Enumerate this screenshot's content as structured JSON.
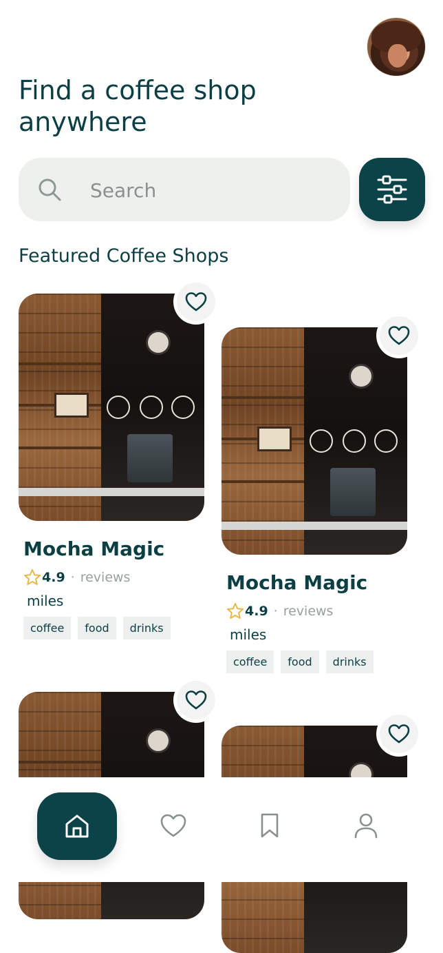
{
  "header": {
    "title": "Find a coffee shop anywhere"
  },
  "search": {
    "placeholder": "Search"
  },
  "featured": {
    "title": "Featured Coffee Shops"
  },
  "cards": [
    {
      "name": "Mocha Magic",
      "rating": "4.9",
      "reviews_label": "reviews",
      "distance": "miles",
      "tags": [
        "coffee",
        "food",
        "drinks"
      ]
    },
    {
      "name": "Mocha Magic",
      "rating": "4.9",
      "reviews_label": "reviews",
      "distance": "miles",
      "tags": [
        "coffee",
        "food",
        "drinks"
      ]
    }
  ],
  "icons": {
    "search": "search-icon",
    "filter": "sliders-icon",
    "favorite": "heart-icon",
    "home": "home-icon",
    "saved": "bookmark-icon",
    "profile": "user-icon",
    "star": "star-icon"
  },
  "colors": {
    "primary": "#0b4349",
    "text": "#0b3f44",
    "surface": "#eef0ee",
    "star": "#e8b84a",
    "muted": "#9aa0a0"
  }
}
